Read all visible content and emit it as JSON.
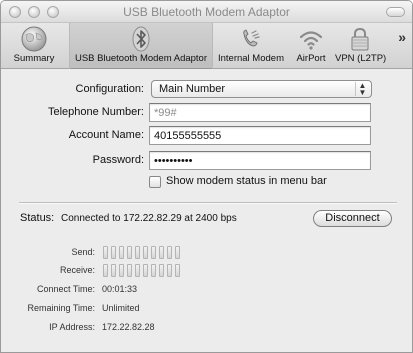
{
  "window": {
    "title": "USB Bluetooth Modem Adaptor"
  },
  "toolbar": {
    "items": [
      {
        "label": "Summary",
        "icon": "globe-icon"
      },
      {
        "label": "USB Bluetooth Modem Adaptor",
        "icon": "bluetooth-icon",
        "selected": true
      },
      {
        "label": "Internal Modem",
        "icon": "phone-icon"
      },
      {
        "label": "AirPort",
        "icon": "wifi-icon"
      },
      {
        "label": "VPN (L2TP)",
        "icon": "lock-icon"
      }
    ],
    "overflow": "»"
  },
  "form": {
    "configuration_label": "Configuration:",
    "configuration_value": "Main Number",
    "telephone_label": "Telephone Number:",
    "telephone_value": "*99#",
    "account_label": "Account Name:",
    "account_value": "40155555555",
    "password_label": "Password:",
    "password_value": "••••••••••",
    "checkbox_label": "Show modem status in menu bar",
    "checkbox_checked": false
  },
  "status": {
    "label": "Status:",
    "text": "Connected to 172.22.82.29 at 2400 bps",
    "button": "Disconnect",
    "send_label": "Send:",
    "receive_label": "Receive:",
    "connect_time_label": "Connect Time:",
    "connect_time_value": "00:01:33",
    "remaining_time_label": "Remaining Time:",
    "remaining_time_value": "Unlimited",
    "ip_label": "IP Address:",
    "ip_value": "172.22.82.28",
    "send_level": 0,
    "receive_level": 0
  }
}
